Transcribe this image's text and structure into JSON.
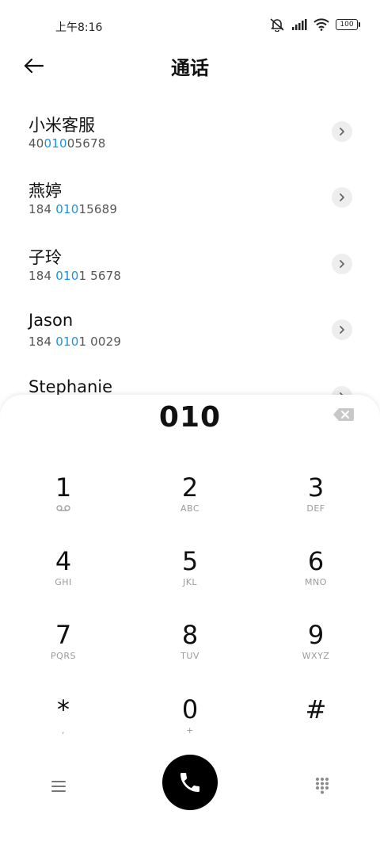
{
  "status": {
    "time": "上午8:16",
    "battery": "100"
  },
  "header": {
    "title": "通话"
  },
  "contacts": [
    {
      "name": "小米客服",
      "number_pre": "40",
      "number_match": "010",
      "number_post": "05678"
    },
    {
      "name": "燕婷",
      "number_pre": "184 ",
      "number_match": "010",
      "number_post": "15689"
    },
    {
      "name": "子玲",
      "number_pre": "184 ",
      "number_match": "010",
      "number_post": "1 5678"
    },
    {
      "name": "Jason",
      "number_pre": "184 ",
      "number_match": "010",
      "number_post": "1 0029"
    },
    {
      "name": "Stephanie",
      "number_pre": "",
      "number_match": "",
      "number_post": ""
    }
  ],
  "dialpad": {
    "dialed": "010",
    "keys": [
      {
        "digit": "1",
        "letters": ""
      },
      {
        "digit": "2",
        "letters": "ABC"
      },
      {
        "digit": "3",
        "letters": "DEF"
      },
      {
        "digit": "4",
        "letters": "GHI"
      },
      {
        "digit": "5",
        "letters": "JKL"
      },
      {
        "digit": "6",
        "letters": "MNO"
      },
      {
        "digit": "7",
        "letters": "PQRS"
      },
      {
        "digit": "8",
        "letters": "TUV"
      },
      {
        "digit": "9",
        "letters": "WXYZ"
      },
      {
        "digit": "*",
        "letters": ","
      },
      {
        "digit": "0",
        "letters": "+"
      },
      {
        "digit": "#",
        "letters": ""
      }
    ]
  },
  "colors": {
    "highlight": "#1d93d8",
    "call_button": "#000000",
    "chevron_bg": "#eeeeee"
  },
  "icons": {
    "back": "arrow-left-icon",
    "chevron": "chevron-right-icon",
    "backspace": "backspace-icon",
    "voicemail": "voicemail-icon",
    "menu": "menu-icon",
    "call": "phone-icon",
    "keypad": "dialpad-icon"
  }
}
